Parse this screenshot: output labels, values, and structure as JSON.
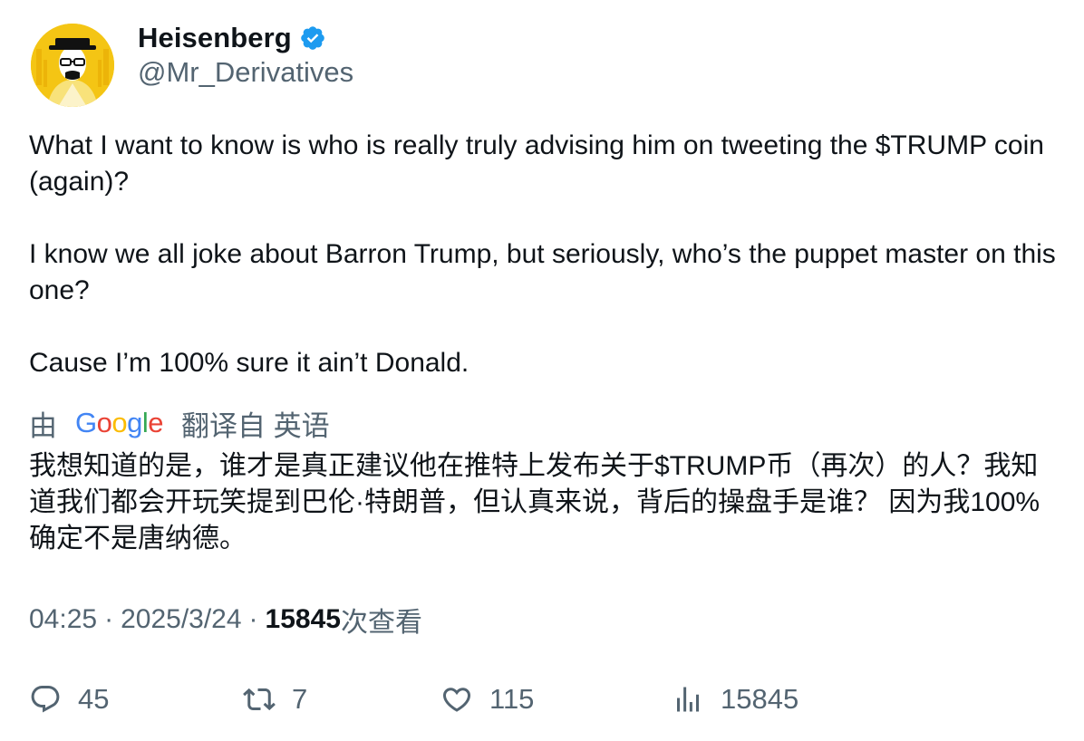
{
  "author": {
    "display_name": "Heisenberg",
    "handle": "@Mr_Derivatives",
    "verified": true,
    "verified_icon": "verified-badge-icon",
    "verified_color": "#1d9bf0",
    "avatar_bg": "#f4c514"
  },
  "tweet": {
    "paragraphs": [
      "What I want to know is who is really truly advising him on tweeting the $TRUMP coin (again)?",
      "I know we all joke about Barron Trump, but seriously, who’s the puppet master on this one?",
      "Cause I’m 100% sure it ain’t Donald."
    ]
  },
  "translation": {
    "prefix": "由",
    "provider_letters": [
      "G",
      "o",
      "o",
      "g",
      "l",
      "e"
    ],
    "provider_colors": [
      "#4285F4",
      "#EA4335",
      "#FBBC05",
      "#4285F4",
      "#34A853",
      "#EA4335"
    ],
    "suffix": "翻译自 英语",
    "text": "我想知道的是，谁才是真正建议他在推特上发布关于$TRUMP币（再次）的人？我知道我们都会开玩笑提到巴伦·特朗普，但认真来说，背后的操盘手是谁？ 因为我100%确定不是唐纳德。"
  },
  "meta": {
    "time": "04:25",
    "separator": "·",
    "date": "2025/3/24",
    "views_count": "15845",
    "views_label": "次查看"
  },
  "actions": {
    "replies": "45",
    "retweets": "7",
    "likes": "115",
    "views": "15845"
  },
  "colors": {
    "text_primary": "#0f1419",
    "text_secondary": "#536471"
  }
}
